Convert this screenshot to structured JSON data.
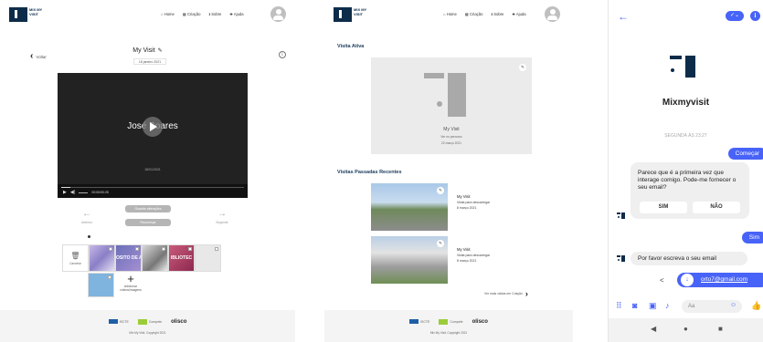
{
  "header": {
    "logo_text": "MIX MY VISIT",
    "nav": [
      "Home",
      "Criação",
      "Sobre",
      "Ajuda"
    ]
  },
  "video_page": {
    "back_label": "Voltar",
    "title": "My Visit",
    "date": "18 janeiro 2021",
    "video_text": "José Soares",
    "video_date": "18/01/2021",
    "time": "00:00/00:25",
    "progress": 0.05,
    "prev_label": "Anterior",
    "next_label": "Seguinte",
    "save_label": "Guardar alterações",
    "regenerate_label": "Recomeçar",
    "trash_label": "Cancelar",
    "thumb_labels": [
      "",
      "OSITO DE A",
      "",
      "IBLIOTEC",
      ""
    ],
    "add_media_label": "Adicionar vídeos/imagens"
  },
  "visits_page": {
    "active_title": "Visita Ativa",
    "active_name": "My Visit",
    "active_sub": "Ver no percurso",
    "active_date": "22 março 2021",
    "recent_title": "Visitas Passadas Recentes",
    "recent": [
      {
        "name": "My Visit",
        "sub": "Visita para descarregar",
        "date": "8 março 2021"
      },
      {
        "name": "My Visit",
        "sub": "Visita para descarregar",
        "date": "8 março 2021"
      }
    ],
    "see_all": "Ver mais visitas em Criação"
  },
  "footer": {
    "copyright": "Mix My Visit, Copyright 2021",
    "logos": [
      "ISCTE",
      "Compete",
      "olisco"
    ]
  },
  "chat": {
    "bot_name": "Mixmyvisit",
    "timestamp": "SEGUNDA ÀS 23:27",
    "msg_start": "Começar",
    "msg_question": "Parece que é a primeira vez que interage comigo. Pode-me fornecer o seu email?",
    "opt_yes": "SIM",
    "opt_no": "NÃO",
    "msg_sim": "Sim",
    "msg_email_prompt": "Por favor escreva o seu email",
    "msg_email": "orto7@gmail.com",
    "composer_placeholder": "Aa"
  },
  "colors": {
    "messenger_blue": "#4863f7",
    "brand_navy": "#0d2c4a"
  }
}
